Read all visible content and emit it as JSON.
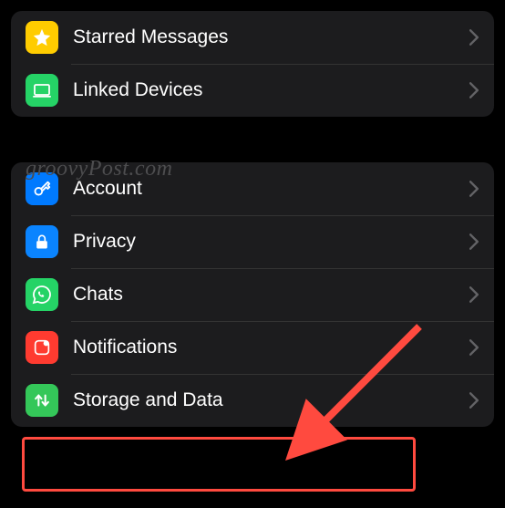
{
  "watermark": "groovyPost.com",
  "sections": [
    {
      "items": [
        {
          "id": "starred",
          "label": "Starred Messages",
          "icon": "star-icon",
          "bg": "bg-yellow"
        },
        {
          "id": "linked",
          "label": "Linked Devices",
          "icon": "laptop-icon",
          "bg": "bg-green"
        }
      ]
    },
    {
      "items": [
        {
          "id": "account",
          "label": "Account",
          "icon": "key-icon",
          "bg": "bg-blue"
        },
        {
          "id": "privacy",
          "label": "Privacy",
          "icon": "lock-icon",
          "bg": "bg-blue2"
        },
        {
          "id": "chats",
          "label": "Chats",
          "icon": "whatsapp-icon",
          "bg": "bg-green"
        },
        {
          "id": "notifications",
          "label": "Notifications",
          "icon": "bell-icon",
          "bg": "bg-red"
        },
        {
          "id": "storage",
          "label": "Storage and Data",
          "icon": "updown-icon",
          "bg": "bg-green2"
        }
      ]
    }
  ]
}
